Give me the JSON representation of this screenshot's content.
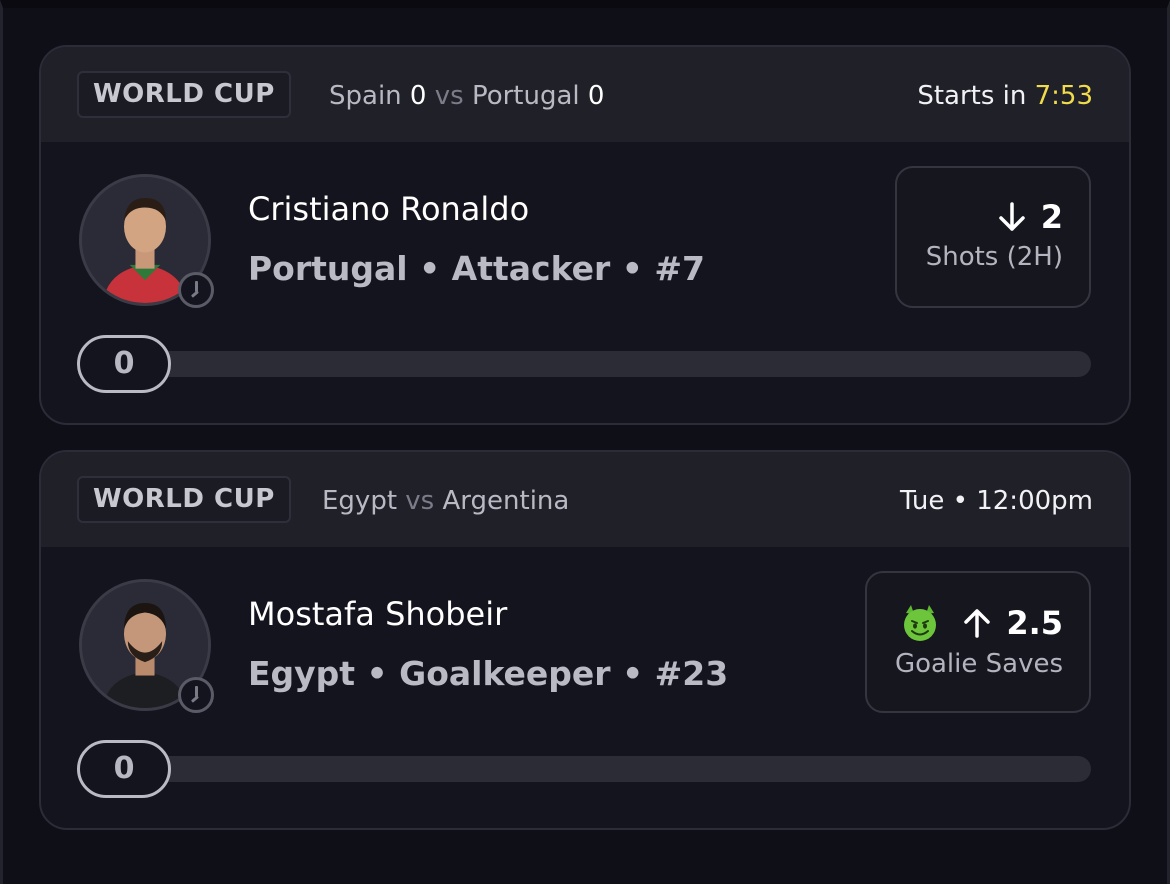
{
  "cards": [
    {
      "league": "WORLD CUP",
      "match": {
        "home": "Spain",
        "home_score": "0",
        "vs": "vs",
        "away": "Portugal",
        "away_score": "0"
      },
      "kickoff": {
        "prefix": "Starts in",
        "time": "7:53"
      },
      "player": {
        "name": "Cristiano Ronaldo",
        "meta": "Portugal • Attacker • #7"
      },
      "stat": {
        "direction": "down",
        "value": "2",
        "label": "Shots (2H)",
        "emoji": ""
      },
      "progress": {
        "value": "0",
        "fraction": 0
      },
      "colors": {
        "kickoff_time": "#f0dc4b"
      },
      "icons": {
        "avatar": "player-photo",
        "clock": "clock-icon",
        "arrow": "arrow-down-icon"
      }
    },
    {
      "league": "WORLD CUP",
      "match": {
        "home": "Egypt",
        "vs": "vs",
        "away": "Argentina"
      },
      "kickoff": {
        "text": "Tue • 12:00pm"
      },
      "player": {
        "name": "Mostafa Shobeir",
        "meta": "Egypt • Goalkeeper • #23"
      },
      "stat": {
        "direction": "up",
        "value": "2.5",
        "label": "Goalie Saves",
        "emoji": "devil-emoji"
      },
      "progress": {
        "value": "0",
        "fraction": 0
      },
      "icons": {
        "avatar": "player-photo",
        "clock": "clock-icon",
        "arrow": "arrow-up-icon"
      }
    }
  ]
}
